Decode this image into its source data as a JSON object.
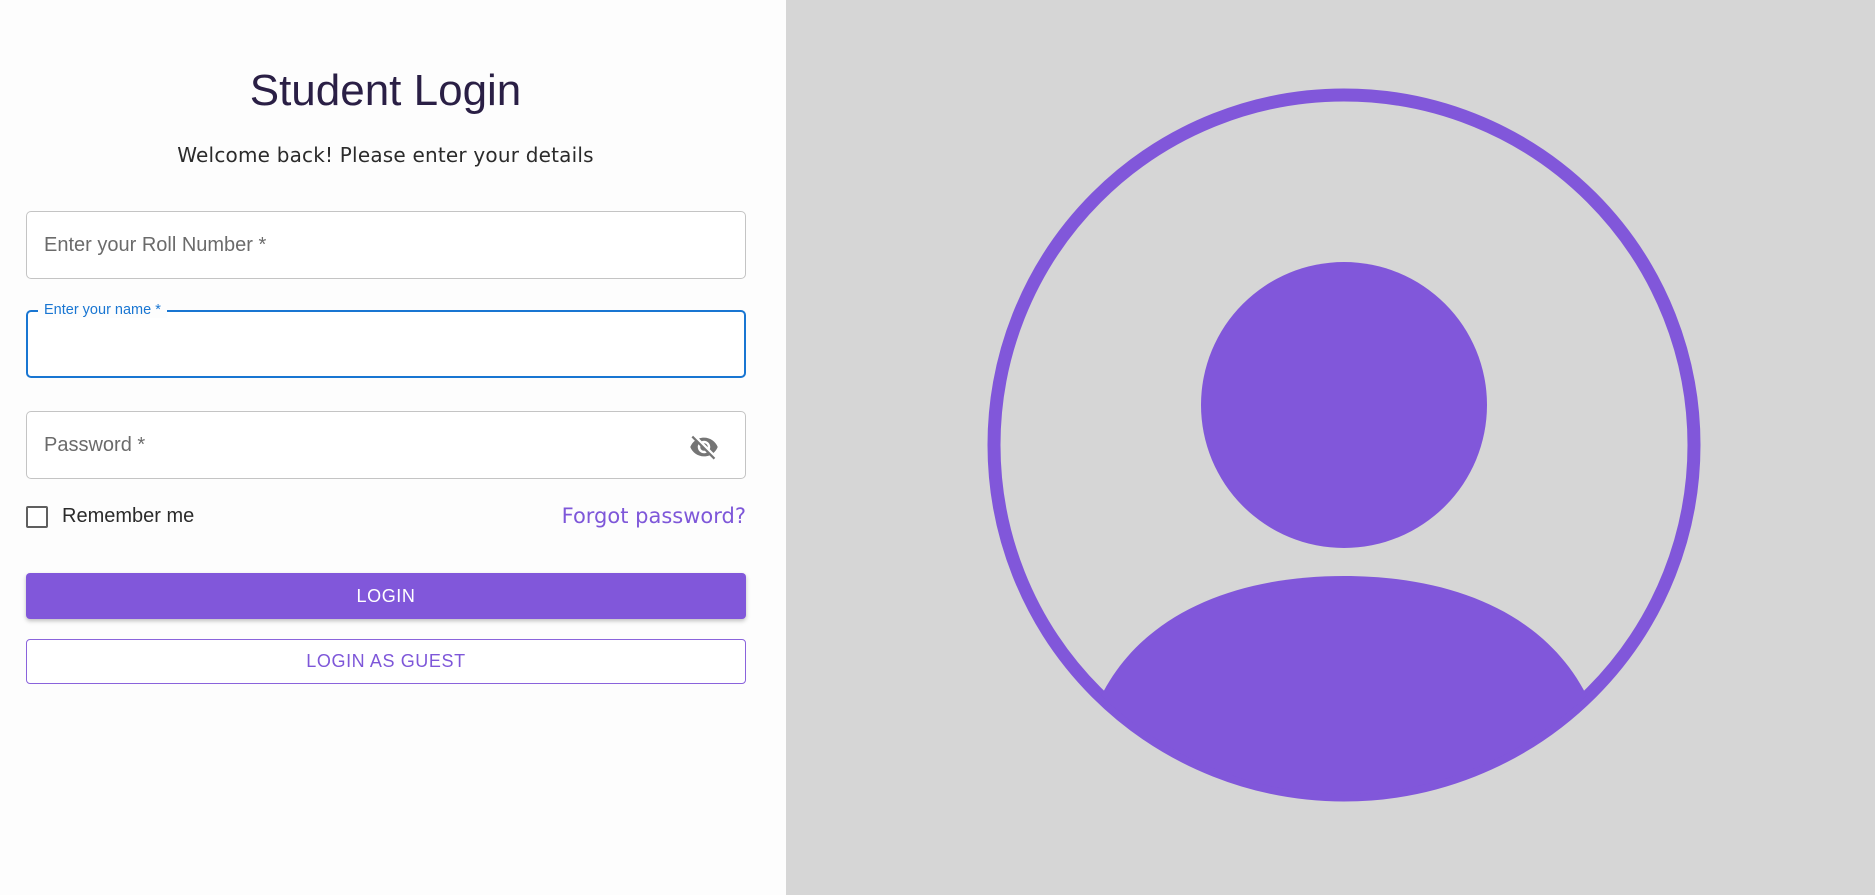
{
  "login": {
    "title": "Student Login",
    "subtitle": "Welcome back! Please enter your details",
    "roll_number_placeholder": "Enter your Roll Number *",
    "name_label": "Enter your name *",
    "name_value": "",
    "password_placeholder": "Password *",
    "remember_label": "Remember me",
    "forgot_label": "Forgot password?",
    "login_label": "LOGIN",
    "guest_label": "LOGIN AS GUEST"
  },
  "icons": {
    "password_toggle": "eye-off-icon",
    "illustration": "user-avatar-icon"
  },
  "colors": {
    "accent": "#8157da",
    "focus": "#1976d2",
    "panel_bg": "#d6d6d6"
  }
}
